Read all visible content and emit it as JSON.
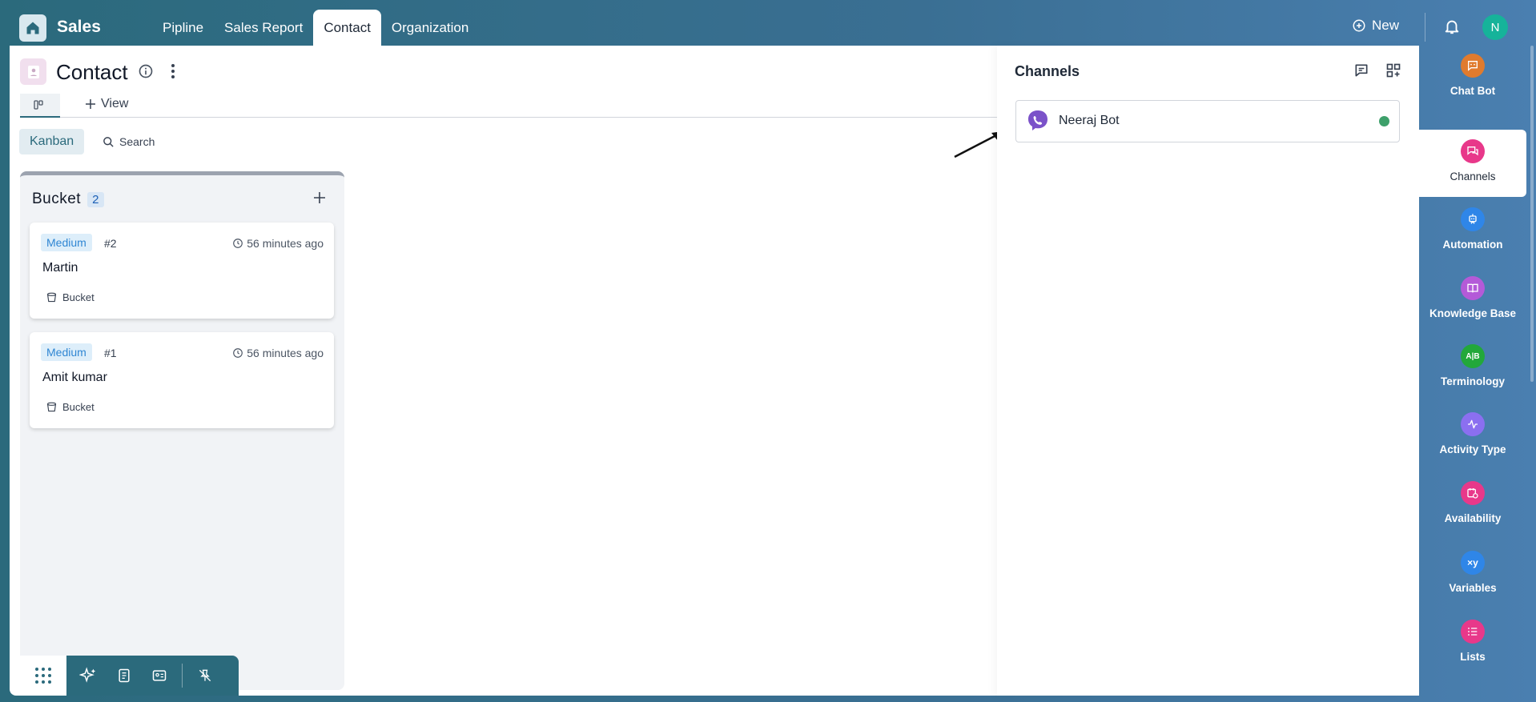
{
  "app": {
    "title": "Sales"
  },
  "nav": {
    "items": [
      {
        "label": "Pipline",
        "active": false
      },
      {
        "label": "Sales Report",
        "active": false
      },
      {
        "label": "Contact",
        "active": true
      },
      {
        "label": "Organization",
        "active": false
      }
    ]
  },
  "header": {
    "new_label": "New",
    "avatar_initial": "N"
  },
  "page": {
    "title": "Contact",
    "add_view_label": "View"
  },
  "toolbar": {
    "kanban_label": "Kanban",
    "search_label": "Search"
  },
  "kanban": {
    "column": {
      "title": "Bucket",
      "count": "2",
      "cards": [
        {
          "priority": "Medium",
          "id": "#2",
          "time": "56 minutes ago",
          "name": "Martin",
          "bucket": "Bucket"
        },
        {
          "priority": "Medium",
          "id": "#1",
          "time": "56 minutes ago",
          "name": "Amit kumar",
          "bucket": "Bucket"
        }
      ]
    }
  },
  "channels": {
    "title": "Channels",
    "items": [
      {
        "name": "Neeraj Bot",
        "status": "online",
        "status_color": "#3ea06b"
      }
    ]
  },
  "rail": {
    "items": [
      {
        "label": "Chat Bot",
        "icon": "chat-bot-icon",
        "color": "#e07b2e",
        "active": false
      },
      {
        "label": "Channels",
        "icon": "channels-icon",
        "color": "#e8388a",
        "active": true
      },
      {
        "label": "Automation",
        "icon": "automation-icon",
        "color": "#2f86e8",
        "active": false
      },
      {
        "label": "Knowledge Base",
        "icon": "book-icon",
        "color": "#b45ad8",
        "active": false
      },
      {
        "label": "Terminology",
        "icon": "ab-icon",
        "color": "#22a83a",
        "active": false
      },
      {
        "label": "Activity Type",
        "icon": "activity-icon",
        "color": "#8b6ff0",
        "active": false
      },
      {
        "label": "Availability",
        "icon": "calendar-clock-icon",
        "color": "#e8388a",
        "active": false
      },
      {
        "label": "Variables",
        "icon": "variables-icon",
        "color": "#2f86e8",
        "active": false
      },
      {
        "label": "Lists",
        "icon": "list-icon",
        "color": "#e8388a",
        "active": false
      }
    ]
  },
  "colors": {
    "brand": "#2b6a7c",
    "accent_blue": "#2f86d3"
  }
}
